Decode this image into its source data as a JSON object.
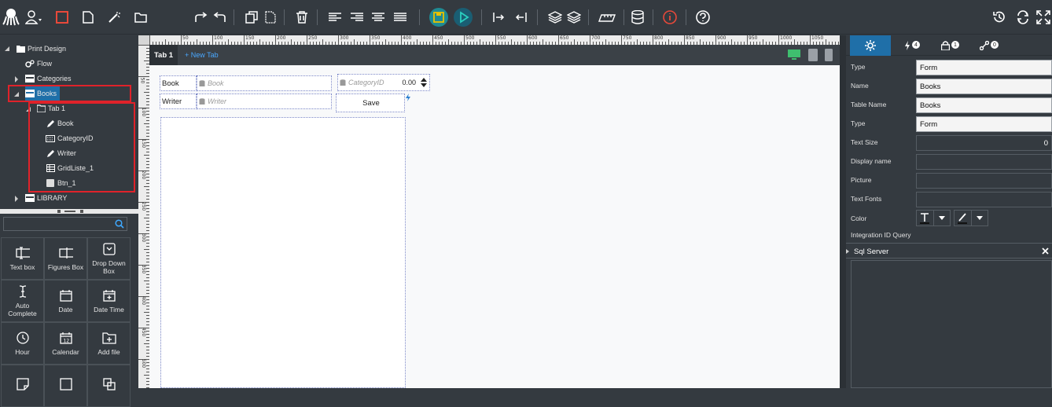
{
  "toolbar": {
    "icons": [
      "octopus-logo-icon",
      "user-icon",
      "square-icon",
      "file-icon",
      "magic-wand-icon",
      "folder-icon",
      "redo-icon",
      "undo-icon",
      "copy-icon",
      "paste-icon",
      "delete-icon",
      "align-left-icon",
      "align-right-icon",
      "align-center-icon",
      "align-justify-icon",
      "save-icon",
      "play-icon",
      "indent-right-icon",
      "indent-left-icon",
      "layers-up-icon",
      "layers-down-icon",
      "ruler-icon",
      "database-icon",
      "info-icon",
      "help-icon",
      "history-icon",
      "refresh-icon",
      "fullscreen-icon"
    ],
    "colors": {
      "save": "#e8c200",
      "play": "#1f9aa6",
      "info": "#e8493a",
      "square": "#e8493a"
    }
  },
  "tree": {
    "root": "Print Design",
    "flow": "Flow",
    "categories": "Categories",
    "books": "Books",
    "tab": "Tab 1",
    "children": [
      "Book",
      "CategoryID",
      "Writer",
      "GridListe_1",
      "Btn_1"
    ],
    "library": "LIBRARY"
  },
  "search": {
    "placeholder": ""
  },
  "tools": [
    {
      "label": "Text box",
      "icon": "textbox-icon"
    },
    {
      "label": "Figures Box",
      "icon": "figures-box-icon"
    },
    {
      "label": "Drop Down Box",
      "icon": "dropdown-icon"
    },
    {
      "label": "Auto Complete",
      "icon": "cursor-text-icon"
    },
    {
      "label": "Date",
      "icon": "date-icon"
    },
    {
      "label": "Date Time",
      "icon": "date-time-icon"
    },
    {
      "label": "Hour",
      "icon": "clock-icon"
    },
    {
      "label": "Calendar",
      "icon": "calendar-icon"
    },
    {
      "label": "Add file",
      "icon": "add-file-icon"
    },
    {
      "label": "",
      "icon": "note-icon"
    },
    {
      "label": "",
      "icon": "square-outline-icon"
    },
    {
      "label": "",
      "icon": "duplicate-icon"
    }
  ],
  "ruler": {
    "top_labels": [
      "50",
      "100",
      "150",
      "200",
      "250",
      "300",
      "350",
      "400",
      "450",
      "500",
      "550",
      "600",
      "650",
      "700",
      "750",
      "800",
      "850",
      "900",
      "950",
      "1000",
      "1050"
    ],
    "left_labels": [
      "50",
      "100",
      "150",
      "200",
      "250",
      "300",
      "350",
      "400",
      "450",
      "500"
    ]
  },
  "tabs": {
    "active": "Tab 1",
    "new": "+ New Tab"
  },
  "form": {
    "book_label": "Book",
    "book_placeholder": "Book",
    "writer_label": "Writer",
    "writer_placeholder": "Writer",
    "category_placeholder": "CategoryID",
    "category_value": "0.00",
    "save_label": "Save"
  },
  "right": {
    "tab_badges": [
      "4",
      "1",
      "0"
    ],
    "properties": [
      {
        "label": "Type",
        "value": "Form"
      },
      {
        "label": "Name",
        "value": "Books"
      },
      {
        "label": "Table Name",
        "value": "Books"
      },
      {
        "label": "Type",
        "value": "Form"
      },
      {
        "label": "Text Size",
        "value": "0"
      },
      {
        "label": "Display name",
        "value": ""
      },
      {
        "label": "Picture",
        "value": ""
      },
      {
        "label": "Text Fonts",
        "value": ""
      }
    ],
    "color_label": "Color",
    "integration_label": "Integration ID Query",
    "sql_label": "Sql Server"
  }
}
